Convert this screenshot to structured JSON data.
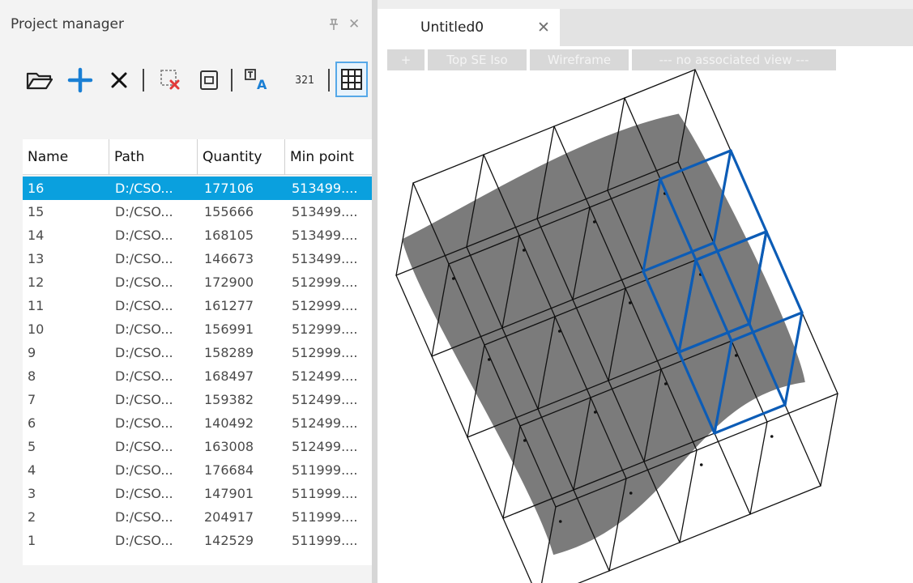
{
  "project_manager": {
    "title": "Project manager",
    "pin_icon": "pin-icon",
    "close_glyph": "✕",
    "toolbar": [
      "open-folder-icon",
      "add-icon",
      "delete-icon",
      "remove-cloud-icon",
      "copy-icon",
      "rename-icon",
      "numbering-icon",
      "grid-icon"
    ],
    "toolbar_numbering_text": "321",
    "columns": [
      "Name",
      "Path",
      "Quantity",
      "Min point"
    ],
    "rows": [
      {
        "name": "16",
        "path": "D:/CSO...",
        "quantity": "177106",
        "min_point": "513499...."
      },
      {
        "name": "15",
        "path": "D:/CSO...",
        "quantity": "155666",
        "min_point": "513499...."
      },
      {
        "name": "14",
        "path": "D:/CSO...",
        "quantity": "168105",
        "min_point": "513499...."
      },
      {
        "name": "13",
        "path": "D:/CSO...",
        "quantity": "146673",
        "min_point": "513499...."
      },
      {
        "name": "12",
        "path": "D:/CSO...",
        "quantity": "172900",
        "min_point": "512999...."
      },
      {
        "name": "11",
        "path": "D:/CSO...",
        "quantity": "161277",
        "min_point": "512999...."
      },
      {
        "name": "10",
        "path": "D:/CSO...",
        "quantity": "156991",
        "min_point": "512999...."
      },
      {
        "name": "9",
        "path": "D:/CSO...",
        "quantity": "158289",
        "min_point": "512999...."
      },
      {
        "name": "8",
        "path": "D:/CSO...",
        "quantity": "168497",
        "min_point": "512499...."
      },
      {
        "name": "7",
        "path": "D:/CSO...",
        "quantity": "159382",
        "min_point": "512499...."
      },
      {
        "name": "6",
        "path": "D:/CSO...",
        "quantity": "140492",
        "min_point": "512499...."
      },
      {
        "name": "5",
        "path": "D:/CSO...",
        "quantity": "163008",
        "min_point": "512499...."
      },
      {
        "name": "4",
        "path": "D:/CSO...",
        "quantity": "176684",
        "min_point": "511999...."
      },
      {
        "name": "3",
        "path": "D:/CSO...",
        "quantity": "147901",
        "min_point": "511999...."
      },
      {
        "name": "2",
        "path": "D:/CSO...",
        "quantity": "204917",
        "min_point": "511999...."
      },
      {
        "name": "1",
        "path": "D:/CSO...",
        "quantity": "142529",
        "min_point": "511999...."
      }
    ],
    "selected_row": "16"
  },
  "viewer": {
    "tab_title": "Untitled0",
    "tab_close": "✕",
    "view_buttons": {
      "add": "+",
      "camera": "Top SE Iso",
      "render_mode": "Wireframe",
      "associated_view": "--- no associated view ---"
    },
    "grid_cols": 4,
    "grid_rows": 4,
    "highlighted_cells": [
      [
        3,
        1
      ],
      [
        3,
        2
      ]
    ],
    "colors": {
      "selection": "#0aa0de",
      "point_cloud": "#7b7b7b",
      "wire": "#111111",
      "highlight": "#0c5cb6"
    }
  }
}
